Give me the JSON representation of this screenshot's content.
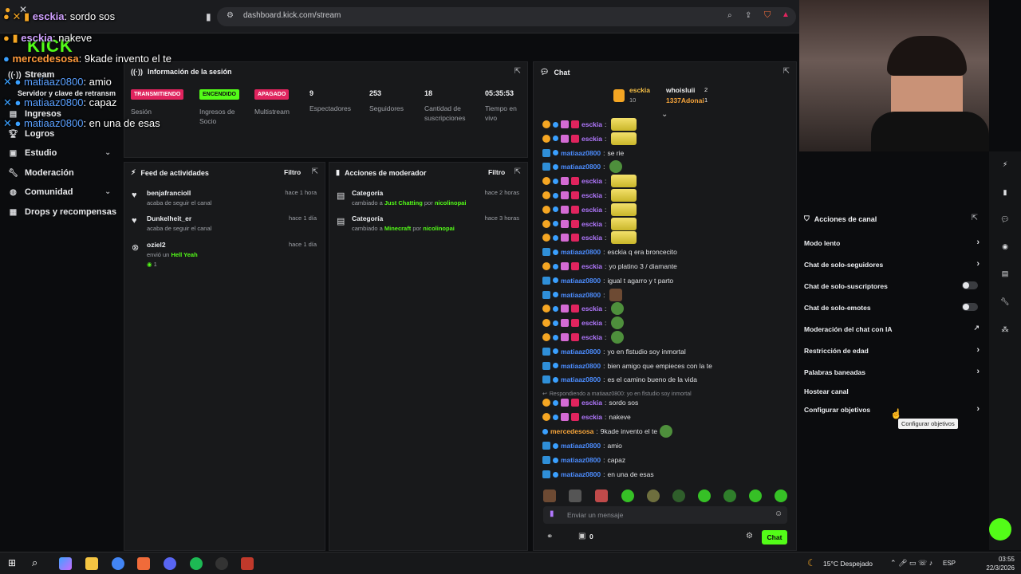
{
  "browser": {
    "url": "dashboard.kick.com/stream"
  },
  "overlay": [
    {
      "user": "esckia",
      "text": "sordo sos"
    },
    {
      "user": "esckia",
      "text": "nakeve"
    },
    {
      "user": "mercedesosa",
      "text": "9kade invento el te"
    },
    {
      "user": "matiaaz0800",
      "text": "amio"
    },
    {
      "user": "matiaaz0800",
      "text": "capaz"
    },
    {
      "user": "matiaaz0800",
      "text": "en una de esas"
    }
  ],
  "logo": "KICK",
  "sidebar": {
    "items": [
      {
        "label": "Stream"
      },
      {
        "label": "Servidor y clave de retransm"
      },
      {
        "label": "Ingresos"
      },
      {
        "label": "Logros"
      },
      {
        "label": "Estudio"
      },
      {
        "label": "Moderación"
      },
      {
        "label": "Comunidad"
      },
      {
        "label": "Drops y recompensas"
      }
    ]
  },
  "session": {
    "title": "Información de la sesión",
    "status_badges": [
      {
        "badge": "TRANSMITIENDO",
        "label": "Sesión",
        "color": "#e0245e"
      },
      {
        "badge": "ENCENDIDO",
        "label": "Ingresos de Socio",
        "color": "#53fc18"
      },
      {
        "badge": "APAGADO",
        "label": "Multistream",
        "color": "#e0245e"
      }
    ],
    "stats": [
      {
        "value": "9",
        "label": "Espectadores"
      },
      {
        "value": "253",
        "label": "Seguidores"
      },
      {
        "value": "18",
        "label": "Cantidad de suscripciones"
      },
      {
        "value": "05:35:53",
        "label": "Tiempo en vivo"
      }
    ]
  },
  "activity": {
    "title": "Feed de actividades",
    "filter": "Filtro",
    "items": [
      {
        "name": "benjafranciolI",
        "sub": "acaba de seguir el canal",
        "time": "hace 1 hora"
      },
      {
        "name": "Dunkelheit_er",
        "sub": "acaba de seguir el canal",
        "time": "hace 1 día"
      },
      {
        "name": "oziel2",
        "sub_prefix": "envió un",
        "sub_highlight": "Hell Yeah",
        "count": "1",
        "time": "hace 1 día"
      }
    ]
  },
  "modactions": {
    "title": "Acciones de moderador",
    "filter": "Filtro",
    "items": [
      {
        "title": "Categoría",
        "prefix": "cambiado a",
        "category": "Just Chatting",
        "by": "por",
        "user": "nicolinopai",
        "time": "hace 2 horas"
      },
      {
        "title": "Categoría",
        "prefix": "cambiado a",
        "category": "Minecraft",
        "by": "por",
        "user": "nicolinopai",
        "time": "hace 3 horas"
      }
    ]
  },
  "chat": {
    "title": "Chat",
    "pinned": [
      {
        "user": "esckia",
        "count": "10"
      },
      {
        "user": "whoisluii",
        "count": "2"
      },
      {
        "user": "1337Adonai",
        "count": "1"
      }
    ],
    "messages": [
      {
        "user": "esckia",
        "text": "",
        "emote": "yellow"
      },
      {
        "user": "esckia",
        "text": "",
        "emote": "yellow"
      },
      {
        "user": "matiaaz0800",
        "text": "se rie"
      },
      {
        "user": "matiaaz0800",
        "text": "",
        "emote": "green"
      },
      {
        "user": "esckia",
        "text": "",
        "emote": "yellow"
      },
      {
        "user": "esckia",
        "text": "",
        "emote": "yellow"
      },
      {
        "user": "esckia",
        "text": "",
        "emote": "yellow"
      },
      {
        "user": "esckia",
        "text": "",
        "emote": "yellow"
      },
      {
        "user": "esckia",
        "text": "",
        "emote": "yellow"
      },
      {
        "user": "matiaaz0800",
        "text": "esckia q era broncecito"
      },
      {
        "user": "esckia",
        "text": "yo platino 3 / diamante"
      },
      {
        "user": "matiaaz0800",
        "text": "igual t agarro y t parto"
      },
      {
        "user": "matiaaz0800",
        "text": "",
        "emote": "brown"
      },
      {
        "user": "esckia",
        "text": "",
        "emote": "green"
      },
      {
        "user": "esckia",
        "text": "",
        "emote": "green"
      },
      {
        "user": "esckia",
        "text": "",
        "emote": "green"
      },
      {
        "user": "matiaaz0800",
        "text": "yo en flstudio soy inmortal"
      },
      {
        "user": "matiaaz0800",
        "text": "bien amigo que empieces con la te"
      },
      {
        "user": "matiaaz0800",
        "text": "es el camino bueno de la vida"
      }
    ],
    "reply_note": "Respondiendo a matiaaz0800: yo en flstudio soy inmortal",
    "messages2": [
      {
        "user": "esckia",
        "text": "sordo sos"
      },
      {
        "user": "esckia",
        "text": "nakeve"
      },
      {
        "user": "mercedesosa",
        "text": "9kade invento el te",
        "emote": "green"
      },
      {
        "user": "matiaaz0800",
        "text": "amio"
      },
      {
        "user": "matiaaz0800",
        "text": "capaz"
      },
      {
        "user": "matiaaz0800",
        "text": "en una de esas"
      }
    ],
    "input_placeholder": "Enviar un mensaje",
    "points": "0",
    "send": "Chat"
  },
  "channel_actions": {
    "title": "Acciones de canal",
    "items": [
      {
        "label": "Modo lento",
        "control": "chevron"
      },
      {
        "label": "Chat de solo-seguidores",
        "control": "chevron"
      },
      {
        "label": "Chat de solo-suscriptores",
        "control": "toggle"
      },
      {
        "label": "Chat de solo-emotes",
        "control": "toggle"
      },
      {
        "label": "Moderación del chat con IA",
        "control": "external"
      },
      {
        "label": "Restricción de edad",
        "control": "chevron"
      },
      {
        "label": "Palabras baneadas",
        "control": "chevron"
      },
      {
        "label": "Hostear canal",
        "control": "none"
      },
      {
        "label": "Configurar objetivos",
        "control": "chevron"
      }
    ],
    "tooltip": "Configurar objetivos"
  },
  "taskbar": {
    "weather": "15°C Despejado",
    "lang": "ESP",
    "time": "03:55",
    "date": "22/3/2026"
  },
  "colors": {
    "accent": "#53fc18",
    "live": "#e0245e"
  }
}
